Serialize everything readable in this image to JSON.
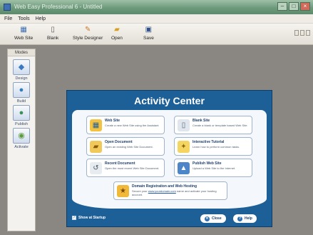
{
  "window": {
    "title": "Web Easy Professional 6 - Untitled"
  },
  "menu": [
    "File",
    "Tools",
    "Help"
  ],
  "toolbar": {
    "buttons": [
      {
        "label": "Web Site",
        "icon": "website-icon"
      },
      {
        "label": "Blank",
        "icon": "blank-page-icon"
      },
      {
        "label": "Style Designer",
        "icon": "style-designer-icon"
      },
      {
        "label": "Open",
        "icon": "open-folder-icon"
      },
      {
        "label": "Save",
        "icon": "save-disk-icon"
      }
    ]
  },
  "sidebar": {
    "title": "Modes",
    "items": [
      {
        "label": "Design",
        "icon": "design-mode-icon"
      },
      {
        "label": "Build",
        "icon": "build-mode-icon"
      },
      {
        "label": "Publish",
        "icon": "publish-mode-icon"
      },
      {
        "label": "Activate",
        "icon": "activate-mode-icon"
      }
    ]
  },
  "activity_center": {
    "title": "Activity Center",
    "tiles": [
      {
        "title": "Web Site",
        "desc": "Create a new Web Site using the Assistant",
        "icon": "website-icon",
        "icon_color": "#f2c240"
      },
      {
        "title": "Blank Site",
        "desc": "Create a blank or template based Web Site.",
        "icon": "blank-page-icon",
        "icon_color": "#dfe6ee"
      },
      {
        "title": "Open Document",
        "desc": "Open an existing Web Site Document.",
        "icon": "open-folder-icon",
        "icon_color": "#f1c95a"
      },
      {
        "title": "Interactive Tutorial",
        "desc": "Learn how to perform common tasks.",
        "icon": "tutorial-icon",
        "icon_color": "#f5d561"
      },
      {
        "title": "Recent Document",
        "desc": "Open the most recent Web Site Document.",
        "icon": "recent-document-icon",
        "icon_color": "#e7ecf1"
      },
      {
        "title": "Publish Web Site",
        "desc": "Upload a Web Site to the Internet.",
        "icon": "publish-icon",
        "icon_color": "#4c86c8"
      }
    ],
    "hosting": {
      "title": "Domain Registration and Web Hosting",
      "desc_prefix": "Secure your",
      "link": "www.yourdomain.com",
      "desc_suffix": "name and activate your hosting account.",
      "icon": "hosting-icon",
      "icon_color": "#f1b93a"
    },
    "show_at_startup": "Show at Startup",
    "close_label": "Close",
    "help_label": "Help"
  },
  "colors": {
    "dialog_blue": "#1d5f97",
    "workspace_gray": "#8a8681"
  }
}
